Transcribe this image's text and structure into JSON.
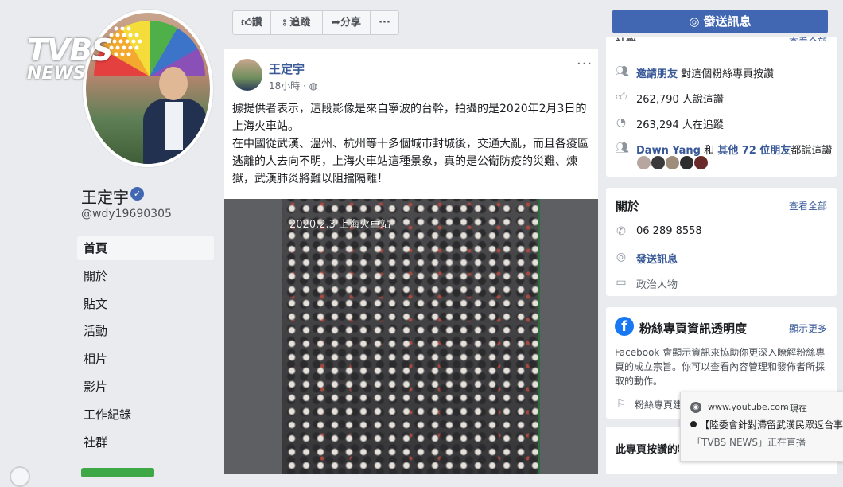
{
  "watermark": {
    "brand": "TVBS",
    "sub": "NEWS"
  },
  "profile": {
    "name": "王定宇",
    "handle": "@wdy19690305"
  },
  "nav": [
    {
      "label": "首頁"
    },
    {
      "label": "關於"
    },
    {
      "label": "貼文"
    },
    {
      "label": "活動"
    },
    {
      "label": "相片"
    },
    {
      "label": "影片"
    },
    {
      "label": "工作紀錄"
    },
    {
      "label": "社群"
    }
  ],
  "actions": {
    "like": "讚",
    "follow": "追蹤",
    "share": "分享",
    "more": "···"
  },
  "post": {
    "author": "王定宇",
    "time": "18小時 · ",
    "more": "···",
    "text": "據提供者表示，這段影像是來自寧波的台幹，拍攝的是2020年2月3日的上海火車站。\n在中國從武漢、溫州、杭州等十多個城市封城後，交通大亂，而且各疫區逃離的人去向不明，上海火車站這種景象，真的是公衛防疫的災難、煉獄，武漢肺炎將難以阻擋隔離！",
    "video_caption": "2020.2.3 上海火車站"
  },
  "right": {
    "send_message": "發送訊息",
    "top_heading": "社群",
    "top_see_all": "查看全部",
    "invite_link": "邀請朋友",
    "invite_rest": "對這個粉絲專頁按讚",
    "likes": "262,790 人說這讚",
    "follows": "263,294 人在追蹤",
    "friends_name": "Dawn Yang",
    "friends_mid": "和",
    "friends_link": "其他 72 位朋友",
    "friends_rest": "都說這讚",
    "about_heading": "關於",
    "about_see_all": "查看全部",
    "phone": "06 289 8558",
    "message_link": "發送訊息",
    "category": "政治人物",
    "transparency_heading": "粉絲專頁資訊透明度",
    "transparency_more": "顯示更多",
    "transparency_text": "Facebook 會顯示資訊來協助你更深入瞭解粉絲專頁的成立宗旨。你可以查看內容管理和發佈者所採取的動作。",
    "page_history": "粉絲專頁建",
    "likes_heading": "此專頁按讚的粉"
  },
  "youtube_popup": {
    "site": "www.youtube.com",
    "time": "· 現在",
    "title": "【陸委會針對滯留武漢民眾返台事宜",
    "channel": "「TVBS NEWS」正在直播"
  },
  "colors": {
    "fb_blue": "#4267b2",
    "link": "#385898",
    "background": "#e9ebee"
  }
}
